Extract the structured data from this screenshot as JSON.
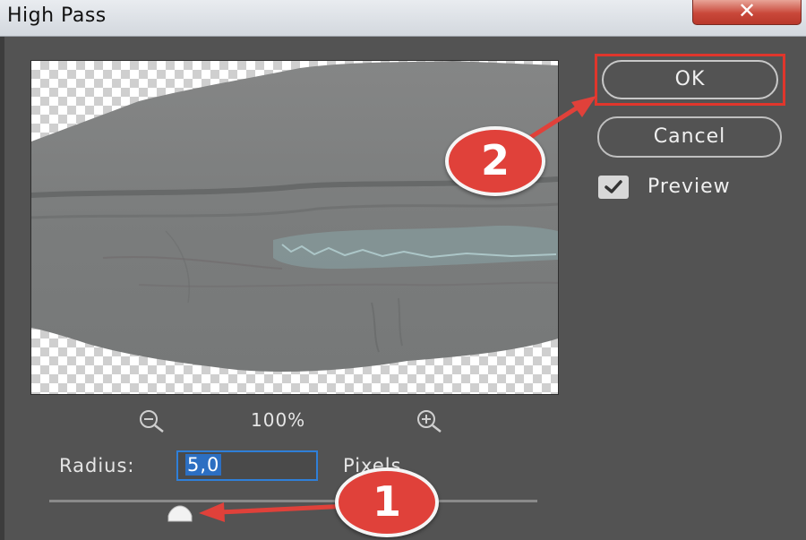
{
  "window": {
    "title": "High Pass",
    "close_label": "✕"
  },
  "zoom": {
    "value": "100%"
  },
  "radius": {
    "label": "Radius:",
    "value": "5,0",
    "unit": "Pixels",
    "slider_position": 0.25
  },
  "buttons": {
    "ok": "OK",
    "cancel": "Cancel"
  },
  "preview_option": {
    "label": "Preview",
    "checked": true
  },
  "annotations": {
    "step1": "1",
    "step2": "2"
  },
  "colors": {
    "dialog_bg": "#535353",
    "annotation_red": "#e0413a",
    "selection_blue": "#2c6fc2"
  }
}
